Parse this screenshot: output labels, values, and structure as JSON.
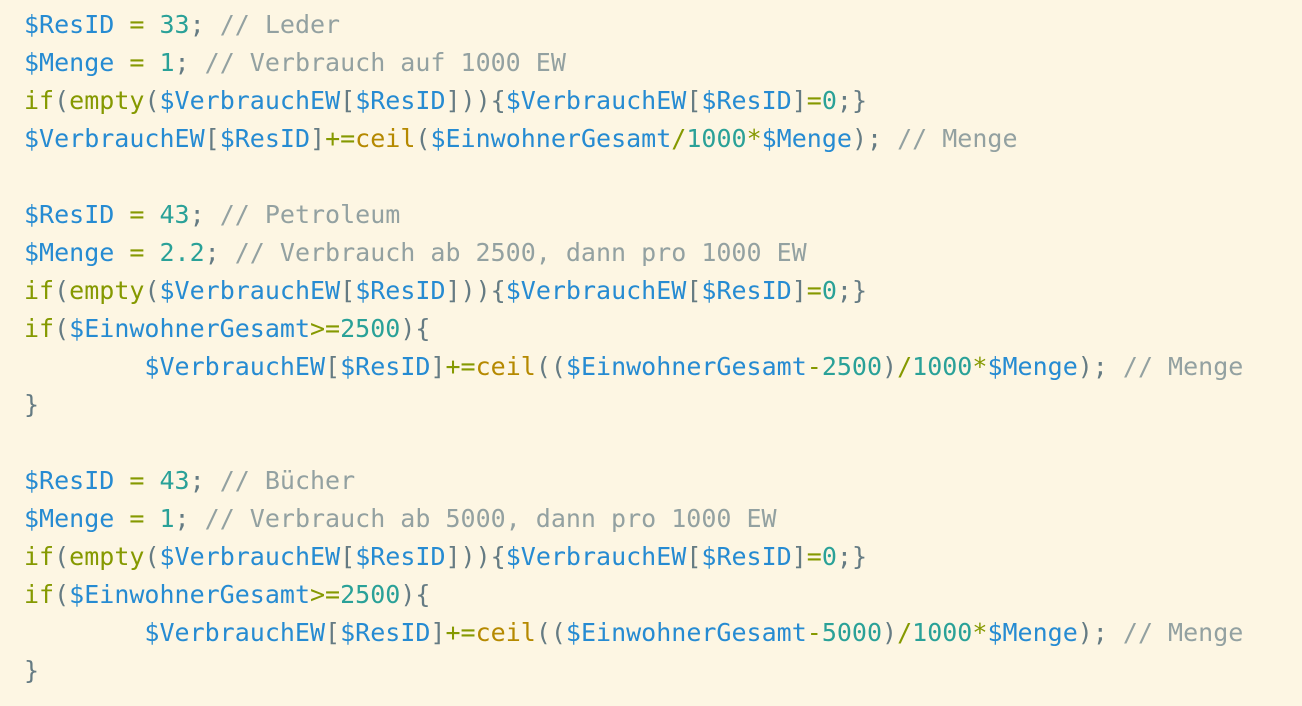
{
  "editor": {
    "lines": [
      [
        {
          "t": "var",
          "v": "$ResID"
        },
        {
          "t": "op",
          "v": " = "
        },
        {
          "t": "num",
          "v": "33"
        },
        {
          "t": "punct",
          "v": "; "
        },
        {
          "t": "comment",
          "v": "// Leder"
        }
      ],
      [
        {
          "t": "var",
          "v": "$Menge"
        },
        {
          "t": "op",
          "v": " = "
        },
        {
          "t": "num",
          "v": "1"
        },
        {
          "t": "punct",
          "v": "; "
        },
        {
          "t": "comment",
          "v": "// Verbrauch auf 1000 EW"
        }
      ],
      [
        {
          "t": "kw",
          "v": "if"
        },
        {
          "t": "punct",
          "v": "("
        },
        {
          "t": "kw",
          "v": "empty"
        },
        {
          "t": "punct",
          "v": "("
        },
        {
          "t": "var",
          "v": "$VerbrauchEW"
        },
        {
          "t": "punct",
          "v": "["
        },
        {
          "t": "var",
          "v": "$ResID"
        },
        {
          "t": "punct",
          "v": "])){"
        },
        {
          "t": "var",
          "v": "$VerbrauchEW"
        },
        {
          "t": "punct",
          "v": "["
        },
        {
          "t": "var",
          "v": "$ResID"
        },
        {
          "t": "punct",
          "v": "]"
        },
        {
          "t": "op",
          "v": "="
        },
        {
          "t": "num",
          "v": "0"
        },
        {
          "t": "punct",
          "v": ";}"
        }
      ],
      [
        {
          "t": "var",
          "v": "$VerbrauchEW"
        },
        {
          "t": "punct",
          "v": "["
        },
        {
          "t": "var",
          "v": "$ResID"
        },
        {
          "t": "punct",
          "v": "]"
        },
        {
          "t": "op",
          "v": "+="
        },
        {
          "t": "fn",
          "v": "ceil"
        },
        {
          "t": "punct",
          "v": "("
        },
        {
          "t": "var",
          "v": "$EinwohnerGesamt"
        },
        {
          "t": "op",
          "v": "/"
        },
        {
          "t": "num",
          "v": "1000"
        },
        {
          "t": "op",
          "v": "*"
        },
        {
          "t": "var",
          "v": "$Menge"
        },
        {
          "t": "punct",
          "v": "); "
        },
        {
          "t": "comment",
          "v": "// Menge"
        }
      ],
      [],
      [
        {
          "t": "var",
          "v": "$ResID"
        },
        {
          "t": "op",
          "v": " = "
        },
        {
          "t": "num",
          "v": "43"
        },
        {
          "t": "punct",
          "v": "; "
        },
        {
          "t": "comment",
          "v": "// Petroleum"
        }
      ],
      [
        {
          "t": "var",
          "v": "$Menge"
        },
        {
          "t": "op",
          "v": " = "
        },
        {
          "t": "num",
          "v": "2.2"
        },
        {
          "t": "punct",
          "v": "; "
        },
        {
          "t": "comment",
          "v": "// Verbrauch ab 2500, dann pro 1000 EW"
        }
      ],
      [
        {
          "t": "kw",
          "v": "if"
        },
        {
          "t": "punct",
          "v": "("
        },
        {
          "t": "kw",
          "v": "empty"
        },
        {
          "t": "punct",
          "v": "("
        },
        {
          "t": "var",
          "v": "$VerbrauchEW"
        },
        {
          "t": "punct",
          "v": "["
        },
        {
          "t": "var",
          "v": "$ResID"
        },
        {
          "t": "punct",
          "v": "])){"
        },
        {
          "t": "var",
          "v": "$VerbrauchEW"
        },
        {
          "t": "punct",
          "v": "["
        },
        {
          "t": "var",
          "v": "$ResID"
        },
        {
          "t": "punct",
          "v": "]"
        },
        {
          "t": "op",
          "v": "="
        },
        {
          "t": "num",
          "v": "0"
        },
        {
          "t": "punct",
          "v": ";}"
        }
      ],
      [
        {
          "t": "kw",
          "v": "if"
        },
        {
          "t": "punct",
          "v": "("
        },
        {
          "t": "var",
          "v": "$EinwohnerGesamt"
        },
        {
          "t": "op",
          "v": ">="
        },
        {
          "t": "num",
          "v": "2500"
        },
        {
          "t": "punct",
          "v": "){"
        }
      ],
      [
        {
          "t": "space",
          "v": "        "
        },
        {
          "t": "var",
          "v": "$VerbrauchEW"
        },
        {
          "t": "punct",
          "v": "["
        },
        {
          "t": "var",
          "v": "$ResID"
        },
        {
          "t": "punct",
          "v": "]"
        },
        {
          "t": "op",
          "v": "+="
        },
        {
          "t": "fn",
          "v": "ceil"
        },
        {
          "t": "punct",
          "v": "(("
        },
        {
          "t": "var",
          "v": "$EinwohnerGesamt"
        },
        {
          "t": "op",
          "v": "-"
        },
        {
          "t": "num",
          "v": "2500"
        },
        {
          "t": "punct",
          "v": ")"
        },
        {
          "t": "op",
          "v": "/"
        },
        {
          "t": "num",
          "v": "1000"
        },
        {
          "t": "op",
          "v": "*"
        },
        {
          "t": "var",
          "v": "$Menge"
        },
        {
          "t": "punct",
          "v": "); "
        },
        {
          "t": "comment",
          "v": "// Menge"
        }
      ],
      [
        {
          "t": "punct",
          "v": "}"
        }
      ],
      [],
      [
        {
          "t": "var",
          "v": "$ResID"
        },
        {
          "t": "op",
          "v": " = "
        },
        {
          "t": "num",
          "v": "43"
        },
        {
          "t": "punct",
          "v": "; "
        },
        {
          "t": "comment",
          "v": "// Bücher"
        }
      ],
      [
        {
          "t": "var",
          "v": "$Menge"
        },
        {
          "t": "op",
          "v": " = "
        },
        {
          "t": "num",
          "v": "1"
        },
        {
          "t": "punct",
          "v": "; "
        },
        {
          "t": "comment",
          "v": "// Verbrauch ab 5000, dann pro 1000 EW"
        }
      ],
      [
        {
          "t": "kw",
          "v": "if"
        },
        {
          "t": "punct",
          "v": "("
        },
        {
          "t": "kw",
          "v": "empty"
        },
        {
          "t": "punct",
          "v": "("
        },
        {
          "t": "var",
          "v": "$VerbrauchEW"
        },
        {
          "t": "punct",
          "v": "["
        },
        {
          "t": "var",
          "v": "$ResID"
        },
        {
          "t": "punct",
          "v": "])){"
        },
        {
          "t": "var",
          "v": "$VerbrauchEW"
        },
        {
          "t": "punct",
          "v": "["
        },
        {
          "t": "var",
          "v": "$ResID"
        },
        {
          "t": "punct",
          "v": "]"
        },
        {
          "t": "op",
          "v": "="
        },
        {
          "t": "num",
          "v": "0"
        },
        {
          "t": "punct",
          "v": ";}"
        }
      ],
      [
        {
          "t": "kw",
          "v": "if"
        },
        {
          "t": "punct",
          "v": "("
        },
        {
          "t": "var",
          "v": "$EinwohnerGesamt"
        },
        {
          "t": "op",
          "v": ">="
        },
        {
          "t": "num",
          "v": "2500"
        },
        {
          "t": "punct",
          "v": "){"
        }
      ],
      [
        {
          "t": "space",
          "v": "        "
        },
        {
          "t": "var",
          "v": "$VerbrauchEW"
        },
        {
          "t": "punct",
          "v": "["
        },
        {
          "t": "var",
          "v": "$ResID"
        },
        {
          "t": "punct",
          "v": "]"
        },
        {
          "t": "op",
          "v": "+="
        },
        {
          "t": "fn",
          "v": "ceil"
        },
        {
          "t": "punct",
          "v": "(("
        },
        {
          "t": "var",
          "v": "$EinwohnerGesamt"
        },
        {
          "t": "op",
          "v": "-"
        },
        {
          "t": "num",
          "v": "5000"
        },
        {
          "t": "punct",
          "v": ")"
        },
        {
          "t": "op",
          "v": "/"
        },
        {
          "t": "num",
          "v": "1000"
        },
        {
          "t": "op",
          "v": "*"
        },
        {
          "t": "var",
          "v": "$Menge"
        },
        {
          "t": "punct",
          "v": "); "
        },
        {
          "t": "comment",
          "v": "// Menge"
        }
      ],
      [
        {
          "t": "punct",
          "v": "}"
        }
      ]
    ]
  },
  "colors": {
    "background": "#fdf6e3",
    "variable": "#268bd2",
    "number": "#2aa198",
    "keyword": "#859900",
    "function": "#b58900",
    "comment": "#93a1a1",
    "punctuation": "#657b83"
  }
}
